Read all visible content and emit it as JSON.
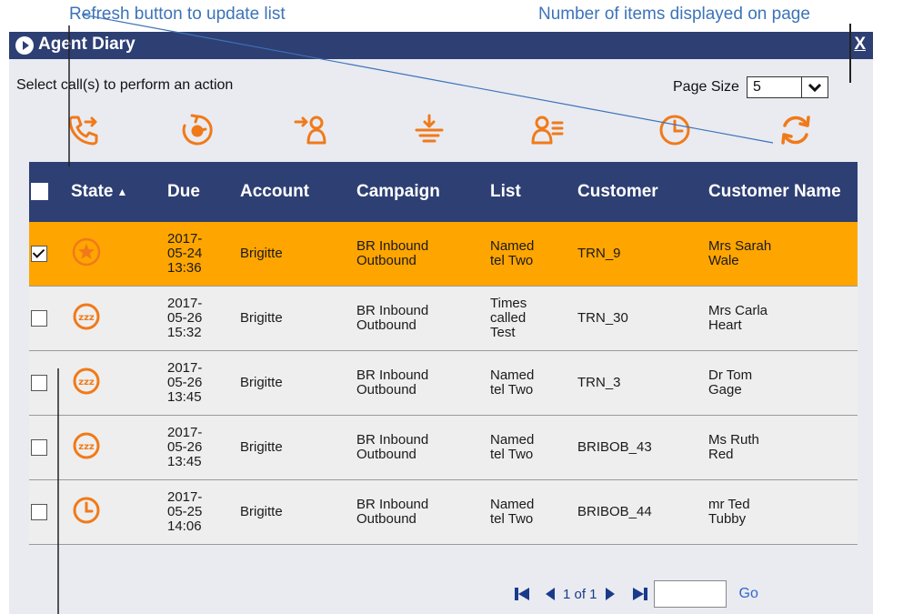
{
  "annotations": {
    "left": "Refresh button to update list",
    "right": "Number of items displayed on page"
  },
  "window": {
    "title": "Agent Diary",
    "close_label": "X"
  },
  "instruction": "Select call(s) to perform an action",
  "page_size": {
    "label": "Page Size",
    "value": "5"
  },
  "toolbar": [
    "call-transfer-icon",
    "timer-icon",
    "assign-agent-icon",
    "ground-icon",
    "agent-list-icon",
    "clock-icon",
    "refresh-icon"
  ],
  "colors": {
    "header_bg": "#2d3f73",
    "selected_row": "#ffa500",
    "icon_orange": "#f07a1a",
    "annotation": "#3d73b8"
  },
  "table": {
    "columns": [
      "State",
      "Due",
      "Account",
      "Campaign",
      "List",
      "Customer",
      "Customer Name"
    ],
    "rows": [
      {
        "selected": true,
        "state_icon": "star-icon",
        "due": [
          "2017-",
          "05-24",
          "13:36"
        ],
        "account": "Brigitte",
        "campaign": [
          "BR Inbound",
          "Outbound"
        ],
        "list": [
          "Named",
          "tel Two"
        ],
        "customer": "TRN_9",
        "customer_name": [
          "Mrs Sarah",
          "Wale"
        ]
      },
      {
        "selected": false,
        "state_icon": "sleep-icon",
        "due": [
          "2017-",
          "05-26",
          "15:32"
        ],
        "account": "Brigitte",
        "campaign": [
          "BR Inbound",
          "Outbound"
        ],
        "list": [
          "Times",
          "called",
          "Test"
        ],
        "customer": "TRN_30",
        "customer_name": [
          "Mrs Carla",
          "Heart"
        ]
      },
      {
        "selected": false,
        "state_icon": "sleep-icon",
        "due": [
          "2017-",
          "05-26",
          "13:45"
        ],
        "account": "Brigitte",
        "campaign": [
          "BR Inbound",
          "Outbound"
        ],
        "list": [
          "Named",
          "tel Two"
        ],
        "customer": "TRN_3",
        "customer_name": [
          "Dr Tom",
          "Gage"
        ]
      },
      {
        "selected": false,
        "state_icon": "sleep-icon",
        "due": [
          "2017-",
          "05-26",
          "13:45"
        ],
        "account": "Brigitte",
        "campaign": [
          "BR Inbound",
          "Outbound"
        ],
        "list": [
          "Named",
          "tel Two"
        ],
        "customer": "BRIBOB_43",
        "customer_name": [
          "Ms Ruth",
          "Red"
        ]
      },
      {
        "selected": false,
        "state_icon": "clock-icon",
        "due": [
          "2017-",
          "05-25",
          "14:06"
        ],
        "account": "Brigitte",
        "campaign": [
          "BR Inbound",
          "Outbound"
        ],
        "list": [
          "Named",
          "tel Two"
        ],
        "customer": "BRIBOB_44",
        "customer_name": [
          "mr Ted",
          "Tubby"
        ]
      }
    ]
  },
  "pager": {
    "text": "1 of 1",
    "input_value": "",
    "go_label": "Go"
  }
}
